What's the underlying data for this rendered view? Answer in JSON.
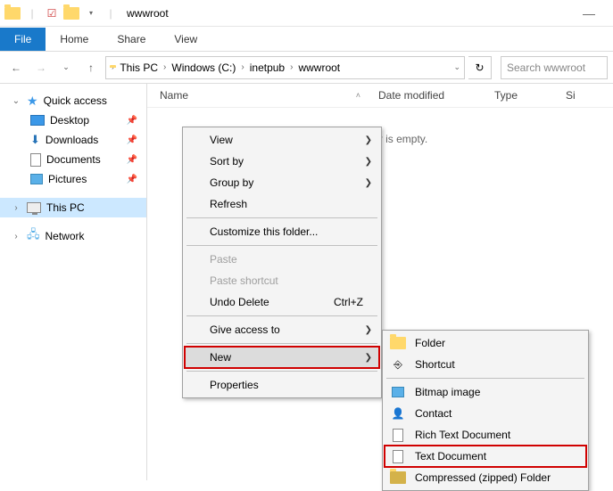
{
  "titlebar": {
    "title": "wwwroot"
  },
  "ribbon": {
    "file": "File",
    "home": "Home",
    "share": "Share",
    "view": "View"
  },
  "breadcrumb": [
    "This PC",
    "Windows (C:)",
    "inetpub",
    "wwwroot"
  ],
  "search": {
    "placeholder": "Search wwwroot"
  },
  "columns": {
    "name": "Name",
    "date": "Date modified",
    "type": "Type",
    "size": "Si"
  },
  "empty": "This folder is empty.",
  "sidebar": {
    "quick": "Quick access",
    "desktop": "Desktop",
    "downloads": "Downloads",
    "documents": "Documents",
    "pictures": "Pictures",
    "thispc": "This PC",
    "network": "Network"
  },
  "menu": {
    "view": "View",
    "sortby": "Sort by",
    "groupby": "Group by",
    "refresh": "Refresh",
    "customize": "Customize this folder...",
    "paste": "Paste",
    "pasteshortcut": "Paste shortcut",
    "undodelete": "Undo Delete",
    "undodelete_sc": "Ctrl+Z",
    "giveaccess": "Give access to",
    "new": "New",
    "properties": "Properties"
  },
  "submenu": {
    "folder": "Folder",
    "shortcut": "Shortcut",
    "bitmap": "Bitmap image",
    "contact": "Contact",
    "rtf": "Rich Text Document",
    "txt": "Text Document",
    "zip": "Compressed (zipped) Folder"
  }
}
